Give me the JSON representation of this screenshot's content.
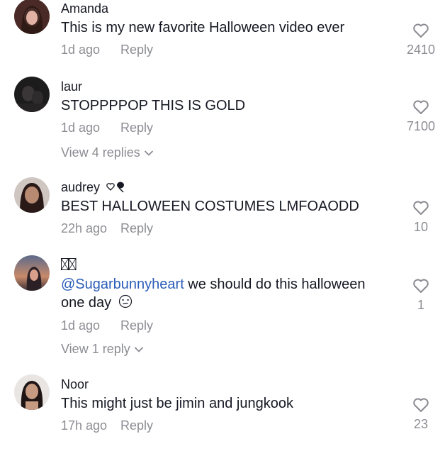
{
  "comments": [
    {
      "username": "Amanda",
      "text": "This is my new favorite Halloween video ever",
      "time": "1d ago",
      "reply_label": "Reply",
      "likes": "2410",
      "avatar_icon": "user-avatar"
    },
    {
      "username": "laur",
      "text": "STOPPPPOP THIS IS GOLD",
      "time": "1d ago",
      "reply_label": "Reply",
      "likes": "7100",
      "view_replies": "View 4 replies",
      "avatar_icon": "user-avatar"
    },
    {
      "username": "audrey",
      "username_icon": "heart-ice-cream-emoji",
      "text": "BEST HALLOWEEN COSTUMES LMFOAODD",
      "time": "22h ago",
      "reply_label": "Reply",
      "likes": "10",
      "avatar_icon": "user-avatar"
    },
    {
      "username_icon": "missing-glyph-boxes",
      "mention": "@Sugarbunnyheart",
      "text_line1": " we should do this halloween",
      "text_line2": "one day",
      "text_emoji": "smirk-emoji",
      "time": "1d ago",
      "reply_label": "Reply",
      "likes": "1",
      "view_replies": "View 1 reply",
      "avatar_icon": "user-avatar"
    },
    {
      "username": "Noor",
      "text": "This might just be jimin and jungkook",
      "time": "17h ago",
      "reply_label": "Reply",
      "likes": "23",
      "avatar_icon": "user-avatar"
    }
  ],
  "colors": {
    "text": "#161823",
    "secondary": "rgba(22,24,35,0.5)",
    "mention": "#2b5db9",
    "background": "#ffffff"
  }
}
